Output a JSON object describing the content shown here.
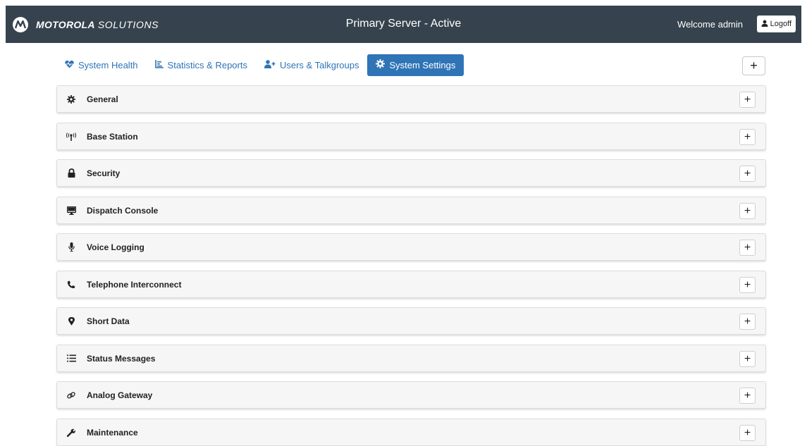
{
  "header": {
    "brand_bold": "MOTOROLA",
    "brand_light": "SOLUTIONS",
    "server_status": "Primary Server - Active",
    "welcome": "Welcome admin",
    "logoff_label": "Logoff",
    "bg_color": "#36434e"
  },
  "tabs": [
    {
      "label": "System Health",
      "icon": "heart-pulse-icon"
    },
    {
      "label": "Statistics & Reports",
      "icon": "chart-icon"
    },
    {
      "label": "Users & Talkgroups",
      "icon": "user-plus-icon"
    },
    {
      "label": "System Settings",
      "icon": "gear-icon",
      "active": true
    }
  ],
  "expand_all_label": "+",
  "sections": [
    {
      "title": "General",
      "icon": "gear-icon",
      "toggle": "+"
    },
    {
      "title": "Base Station",
      "icon": "antenna-icon",
      "toggle": "+"
    },
    {
      "title": "Security",
      "icon": "lock-icon",
      "toggle": "+"
    },
    {
      "title": "Dispatch Console",
      "icon": "desktop-icon",
      "toggle": "+"
    },
    {
      "title": "Voice Logging",
      "icon": "microphone-icon",
      "toggle": "+"
    },
    {
      "title": "Telephone Interconnect",
      "icon": "phone-icon",
      "toggle": "+"
    },
    {
      "title": "Short Data",
      "icon": "map-marker-icon",
      "toggle": "+"
    },
    {
      "title": "Status Messages",
      "icon": "list-icon",
      "toggle": "+"
    },
    {
      "title": "Analog Gateway",
      "icon": "link-icon",
      "toggle": "+"
    },
    {
      "title": "Maintenance",
      "icon": "wrench-icon",
      "toggle": "+"
    }
  ],
  "accent_color": "#2f74b6"
}
